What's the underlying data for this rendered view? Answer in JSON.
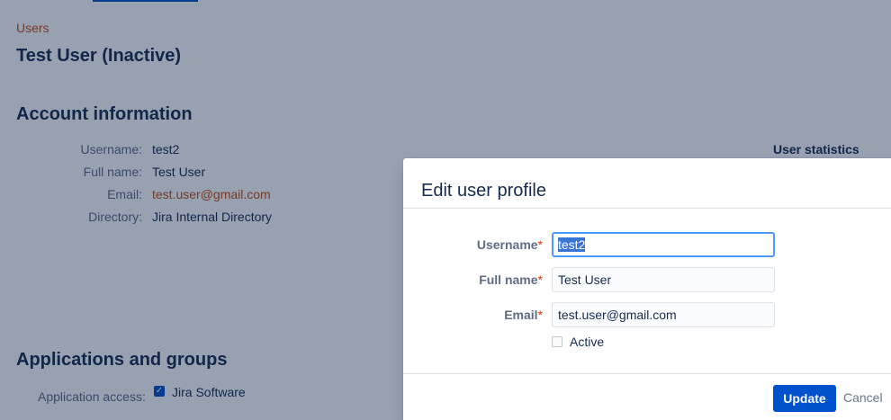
{
  "breadcrumb": "Users",
  "page_title": "Test User (Inactive)",
  "account_section": {
    "title": "Account information",
    "fields": [
      {
        "label": "Username:",
        "value": "test2"
      },
      {
        "label": "Full name:",
        "value": "Test User"
      },
      {
        "label": "Email:",
        "value": "test.user@gmail.com"
      },
      {
        "label": "Directory:",
        "value": "Jira Internal Directory"
      }
    ],
    "stats_title": "User statistics"
  },
  "apps_section": {
    "title": "Applications and groups",
    "access_label": "Application access:",
    "app_name": "Jira Software",
    "app_checked": true
  },
  "dialog": {
    "title": "Edit user profile",
    "required_marker": "*",
    "username": {
      "label": "Username",
      "value": "test2"
    },
    "fullname": {
      "label": "Full name",
      "value": "Test User"
    },
    "email": {
      "label": "Email",
      "value": "test.user@gmail.com"
    },
    "active": {
      "label": "Active",
      "checked": false
    },
    "update_label": "Update",
    "cancel_label": "Cancel"
  },
  "colors": {
    "accent": "#0052cc",
    "link": "#c4501a",
    "required": "#de350b"
  }
}
